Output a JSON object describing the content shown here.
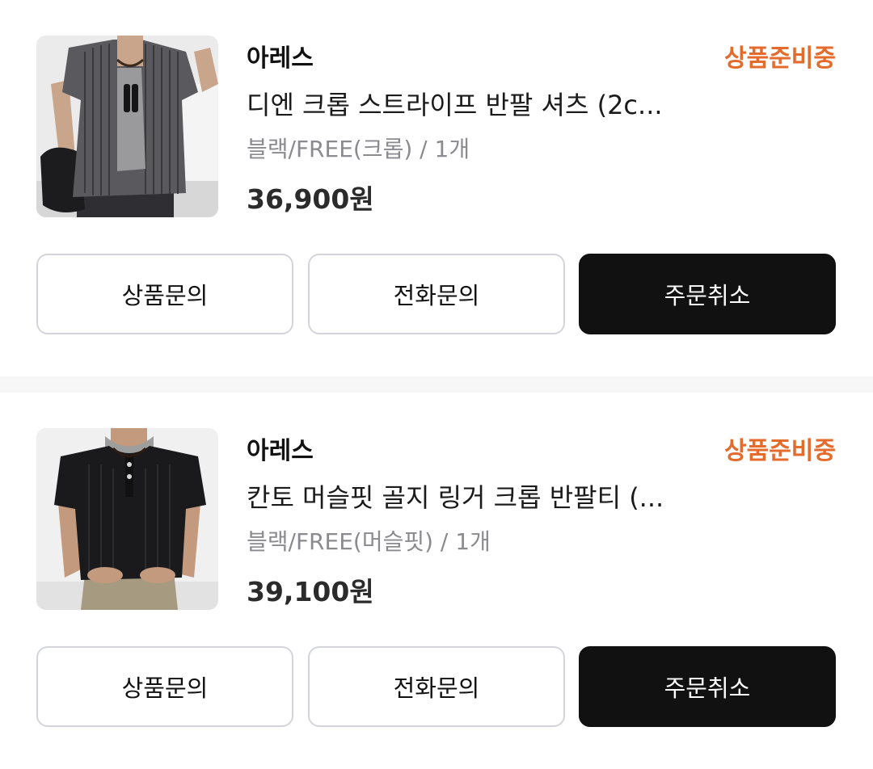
{
  "orders": [
    {
      "brand": "아레스",
      "status": "상품준비중",
      "product_name": "디엔 크롭 스트라이프 반팔 셔츠 (2c...",
      "option": "블랙/FREE(크롭) / 1개",
      "price": "36,900원",
      "image_icon": "striped-shirt-photo",
      "buttons": {
        "inquiry": "상품문의",
        "call": "전화문의",
        "cancel": "주문취소"
      }
    },
    {
      "brand": "아레스",
      "status": "상품준비중",
      "product_name": "칸토 머슬핏 골지 링거 크롭 반팔티 (...",
      "option": "블랙/FREE(머슬핏) / 1개",
      "price": "39,100원",
      "image_icon": "black-tee-photo",
      "buttons": {
        "inquiry": "상품문의",
        "call": "전화문의",
        "cancel": "주문취소"
      }
    }
  ],
  "colors": {
    "status": "#e56b2d",
    "primary_button": "#111111",
    "outline_border": "#d3d5da",
    "divider": "#f7f7f8"
  }
}
